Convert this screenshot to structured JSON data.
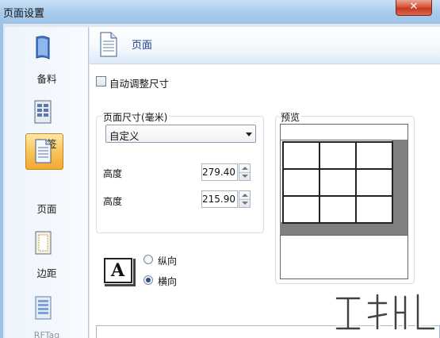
{
  "window": {
    "title": "页面设置",
    "close_label": "✕"
  },
  "sidebar": {
    "items": [
      {
        "label": "备料",
        "icon": "book-icon",
        "active": false
      },
      {
        "label": "标签",
        "icon": "label-sheet-icon",
        "active": false
      },
      {
        "label": "页面",
        "icon": "page-icon",
        "active": true
      },
      {
        "label": "边距",
        "icon": "margin-icon",
        "active": false
      },
      {
        "label": "RFTag",
        "icon": "rfid-tag-icon",
        "active": false
      }
    ]
  },
  "header": {
    "title": "页面",
    "icon": "page-icon"
  },
  "auto_size": {
    "label": "自动调整尺寸",
    "checked": false
  },
  "page_size": {
    "group_title": "页面尺寸(毫米)",
    "selected": "自定义",
    "height_label": "高度",
    "height_value": "279.40",
    "width_label": "高度",
    "width_value": "215.90"
  },
  "orientation": {
    "icon_letter": "A",
    "portrait_label": "纵向",
    "landscape_label": "横向",
    "selected": "landscape"
  },
  "preview": {
    "title": "预览",
    "rows": 3,
    "cols": 3
  }
}
